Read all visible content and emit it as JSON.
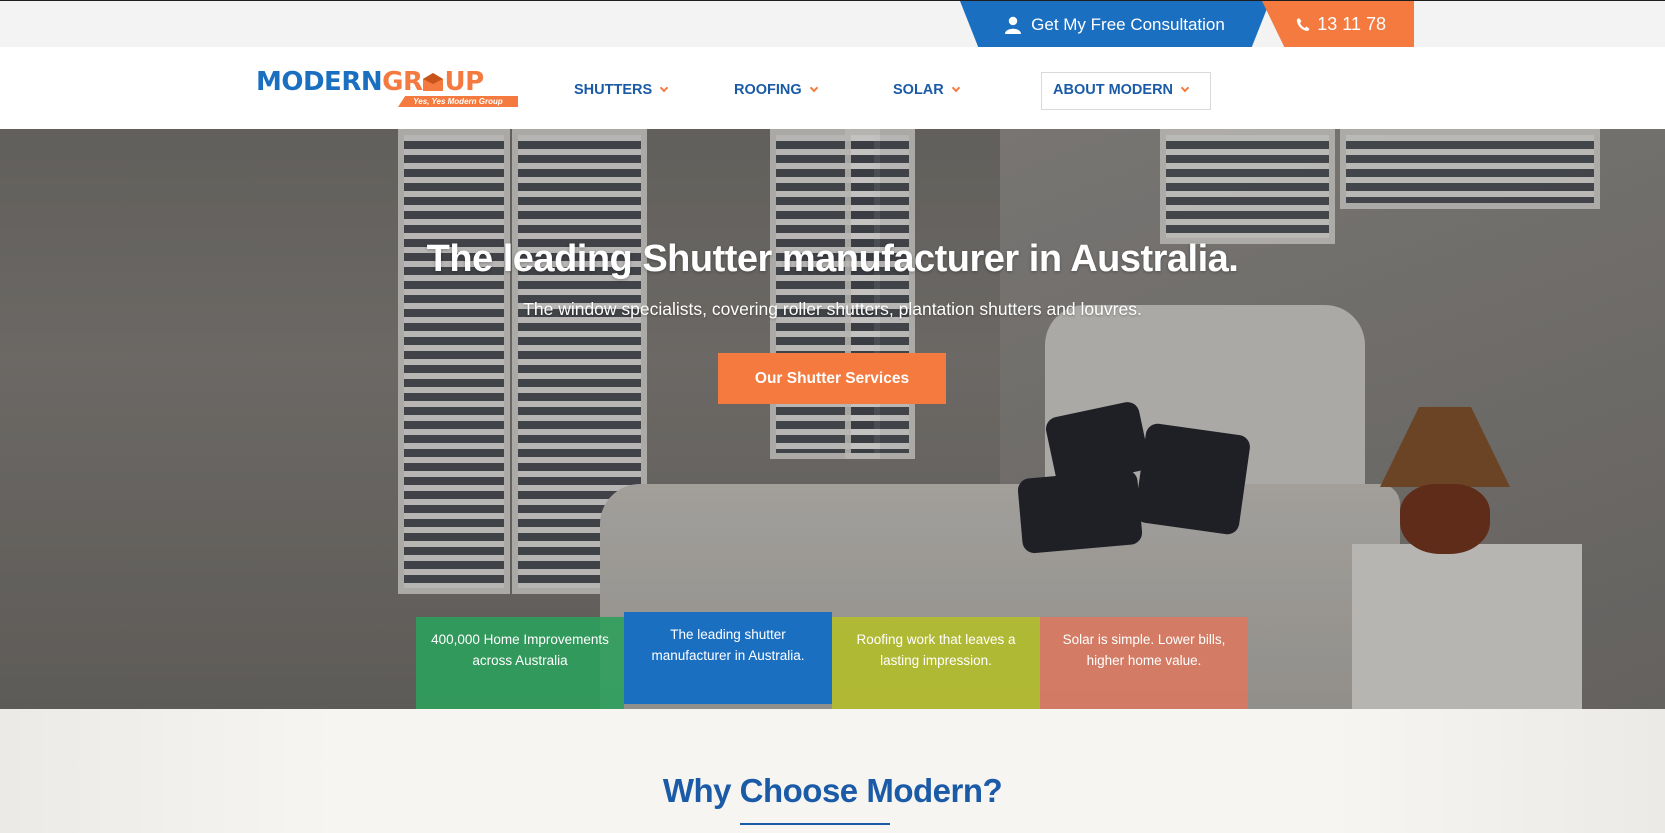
{
  "topbar": {
    "consult_label": "Get My Free Consultation",
    "phone": "13 11 78"
  },
  "brand": {
    "logo_part1": "MODERN",
    "logo_part2": "GR",
    "logo_part3": "UP",
    "tagline": "Yes, Yes Modern Group",
    "blue": "#1b6fc1",
    "orange": "#f47a3f"
  },
  "nav": {
    "items": [
      {
        "label": "SHUTTERS"
      },
      {
        "label": "ROOFING"
      },
      {
        "label": "SOLAR"
      },
      {
        "label": "ABOUT MODERN"
      }
    ]
  },
  "hero": {
    "title": "The leading Shutter manufacturer in Australia.",
    "subtitle": "The window specialists, covering roller shutters, plantation shutters and louvres.",
    "cta_label": "Our Shutter Services"
  },
  "tiles": [
    {
      "text": "400,000 Home Improvements across Australia",
      "color": "#2ea05c"
    },
    {
      "text": "The leading shutter manufacturer in Australia.",
      "color": "#1b6fc1"
    },
    {
      "text": "Roofing work that leaves a lasting impression.",
      "color": "#b4be28"
    },
    {
      "text": "Solar is simple. Lower bills, higher home value.",
      "color": "#dc785f"
    }
  ],
  "why": {
    "title": "Why Choose Modern?"
  }
}
